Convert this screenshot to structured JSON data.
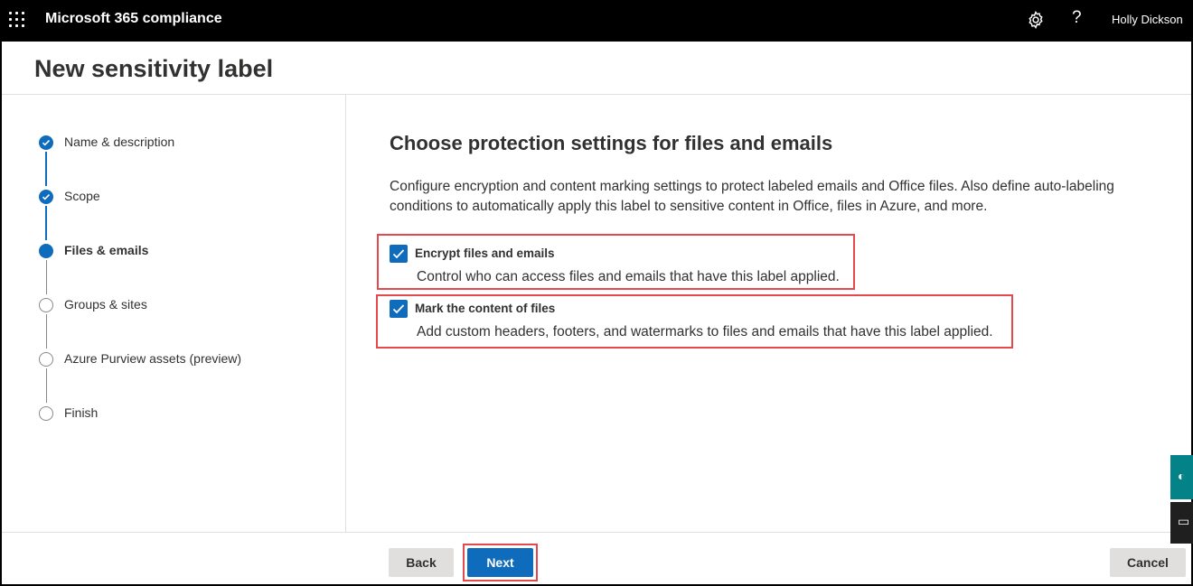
{
  "header": {
    "app_name": "Microsoft 365 compliance",
    "user_name": "Holly Dickson",
    "help_glyph": "?",
    "icons": [
      "waffle-icon",
      "gear-icon",
      "help-icon"
    ]
  },
  "page_title": "New sensitivity label",
  "steps": [
    {
      "label": "Name & description",
      "state": "done"
    },
    {
      "label": "Scope",
      "state": "done"
    },
    {
      "label": "Files & emails",
      "state": "current"
    },
    {
      "label": "Groups & sites",
      "state": "todo"
    },
    {
      "label": "Azure Purview assets (preview)",
      "state": "todo"
    },
    {
      "label": "Finish",
      "state": "todo"
    }
  ],
  "main": {
    "heading": "Choose protection settings for files and emails",
    "description": "Configure encryption and content marking settings to protect labeled emails and Office files. Also define auto-labeling conditions to automatically apply this label to sensitive content in Office, files in Azure, and more.",
    "options": [
      {
        "title": "Encrypt files and emails",
        "subtitle": "Control who can access files and emails that have this label applied.",
        "checked": true
      },
      {
        "title": "Mark the content of files",
        "subtitle": "Add custom headers, footers, and watermarks to files and emails that have this label applied.",
        "checked": true
      }
    ]
  },
  "footer": {
    "back_label": "Back",
    "next_label": "Next",
    "cancel_label": "Cancel"
  },
  "colors": {
    "accent": "#0f6cbd",
    "highlight": "#e5484d",
    "side_tab": "#038387"
  }
}
